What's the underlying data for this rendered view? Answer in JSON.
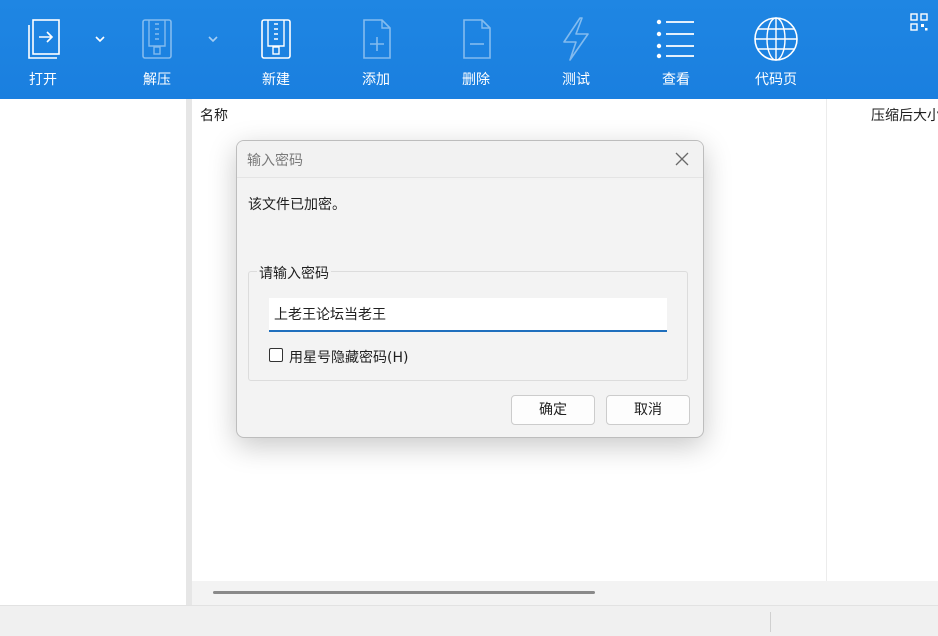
{
  "toolbar": {
    "open": {
      "label": "打开",
      "icon": "open-icon"
    },
    "extract": {
      "label": "解压",
      "icon": "extract-icon"
    },
    "new": {
      "label": "新建",
      "icon": "new-archive-icon"
    },
    "add": {
      "label": "添加",
      "icon": "add-file-icon"
    },
    "delete": {
      "label": "删除",
      "icon": "delete-file-icon"
    },
    "test": {
      "label": "测试",
      "icon": "test-icon"
    },
    "view": {
      "label": "查看",
      "icon": "list-view-icon"
    },
    "codepage": {
      "label": "代码页",
      "icon": "globe-icon"
    },
    "accent_color": "#1a7fdf"
  },
  "file_list": {
    "columns": {
      "name": "名称",
      "compressed_size": "压缩后大小"
    }
  },
  "dialog": {
    "title": "输入密码",
    "message": "该文件已加密。",
    "group_label": "请输入密码",
    "password_value": "上老王论坛当老王",
    "hide_password_label": "用星号隐藏密码(H)",
    "hide_password_checked": false,
    "ok_label": "确定",
    "cancel_label": "取消",
    "focus_color": "#1f6fbd"
  }
}
